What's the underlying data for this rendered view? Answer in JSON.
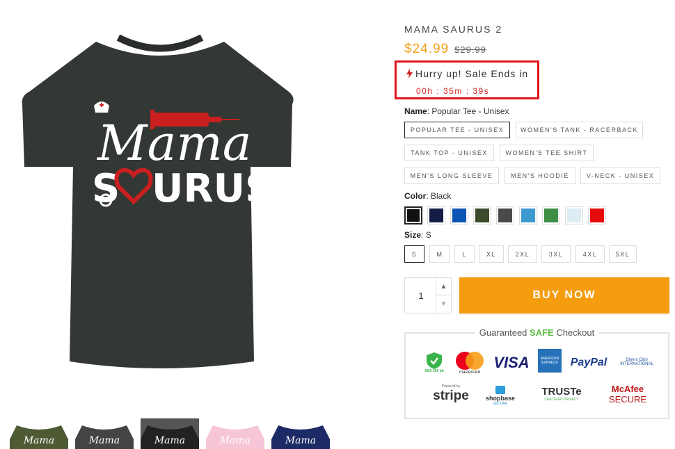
{
  "product": {
    "title": "MAMA SAURUS 2",
    "price": "$24.99",
    "compare_price": "$29.99",
    "image_text_line1": "Mama",
    "image_text_line2": "S",
    "image_text_line3": "URUS"
  },
  "sale": {
    "message": "Hurry up! Sale Ends in",
    "countdown": "00h : 35m : 39s"
  },
  "options": {
    "name_label": "Name",
    "name_value": "Popular Tee - Unisex",
    "styles": [
      "POPULAR TEE - UNISEX",
      "WOMEN'S TANK - RACERBACK",
      "TANK TOP - UNISEX",
      "WOMEN'S TEE SHIRT",
      "MEN'S LONG SLEEVE",
      "MEN'S HOODIE",
      "V-NECK - UNISEX"
    ],
    "color_label": "Color",
    "color_value": "Black",
    "colors": [
      "#111111",
      "#141d45",
      "#0b54b3",
      "#3c4a2b",
      "#4a4a4a",
      "#3d9ad1",
      "#3e8f45",
      "#dcedf4",
      "#e60b0b"
    ],
    "size_label": "Size",
    "size_value": "S",
    "sizes": [
      "S",
      "M",
      "L",
      "XL",
      "2XL",
      "3XL",
      "4XL",
      "5XL"
    ]
  },
  "cart": {
    "quantity": "1",
    "buy_label": "BUY NOW"
  },
  "trust": {
    "title_prefix": "Guaranteed ",
    "title_safe": "SAFE",
    "title_suffix": " Checkout",
    "logos": [
      "AES 256 bit",
      "mastercard",
      "VISA",
      "AMERICAN EXPRESS",
      "PayPal",
      "Diners Club INTERNATIONAL",
      "Powered by",
      "stripe",
      "shopbase",
      "SECURE",
      "TRUSTe",
      "CERTIFIED PRIVACY",
      "McAfee",
      "SECURE"
    ]
  },
  "thumbnail_colors": [
    "#4d5a34",
    "#444444",
    "#222222",
    "#f6c5d8",
    "#1c2a66"
  ]
}
